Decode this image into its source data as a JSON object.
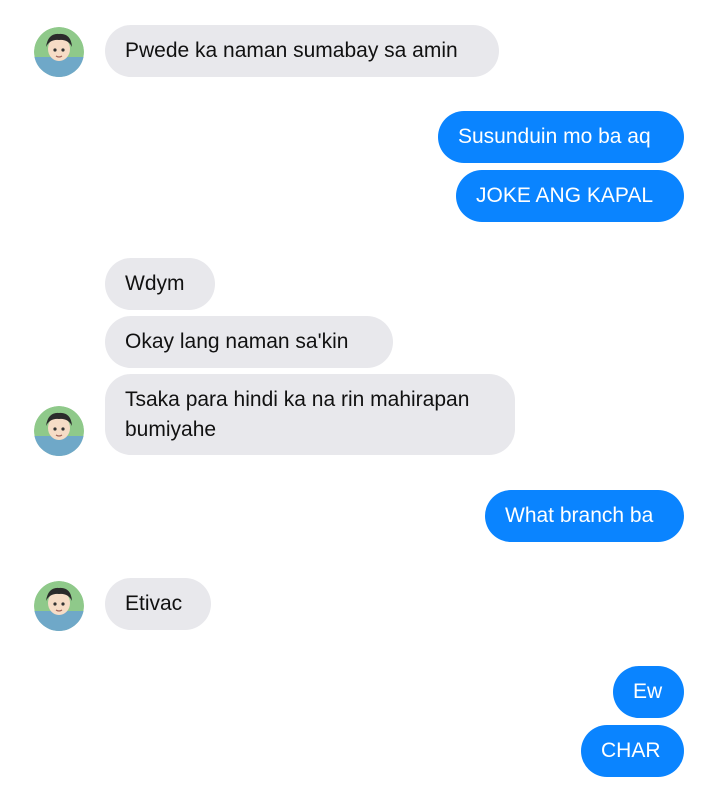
{
  "conversation": {
    "messages": [
      {
        "direction": "incoming",
        "text": "Pwede ka naman sumabay sa amin"
      },
      {
        "direction": "outgoing",
        "text": "Susunduin mo ba aq"
      },
      {
        "direction": "outgoing",
        "text": "JOKE ANG KAPAL"
      },
      {
        "direction": "incoming",
        "text": "Wdym"
      },
      {
        "direction": "incoming",
        "text": "Okay lang naman sa'kin"
      },
      {
        "direction": "incoming",
        "text": "Tsaka para hindi ka na rin mahirapan bumiyahe"
      },
      {
        "direction": "outgoing",
        "text": "What branch ba"
      },
      {
        "direction": "incoming",
        "text": "Etivac"
      },
      {
        "direction": "outgoing",
        "text": "Ew"
      },
      {
        "direction": "outgoing",
        "text": "CHAR"
      }
    ]
  },
  "colors": {
    "incoming_bubble": "#e8e8ec",
    "outgoing_bubble": "#0a84ff",
    "incoming_text": "#111111",
    "outgoing_text": "#ffffff"
  },
  "icons": {
    "avatar": "contact-avatar-icon"
  }
}
